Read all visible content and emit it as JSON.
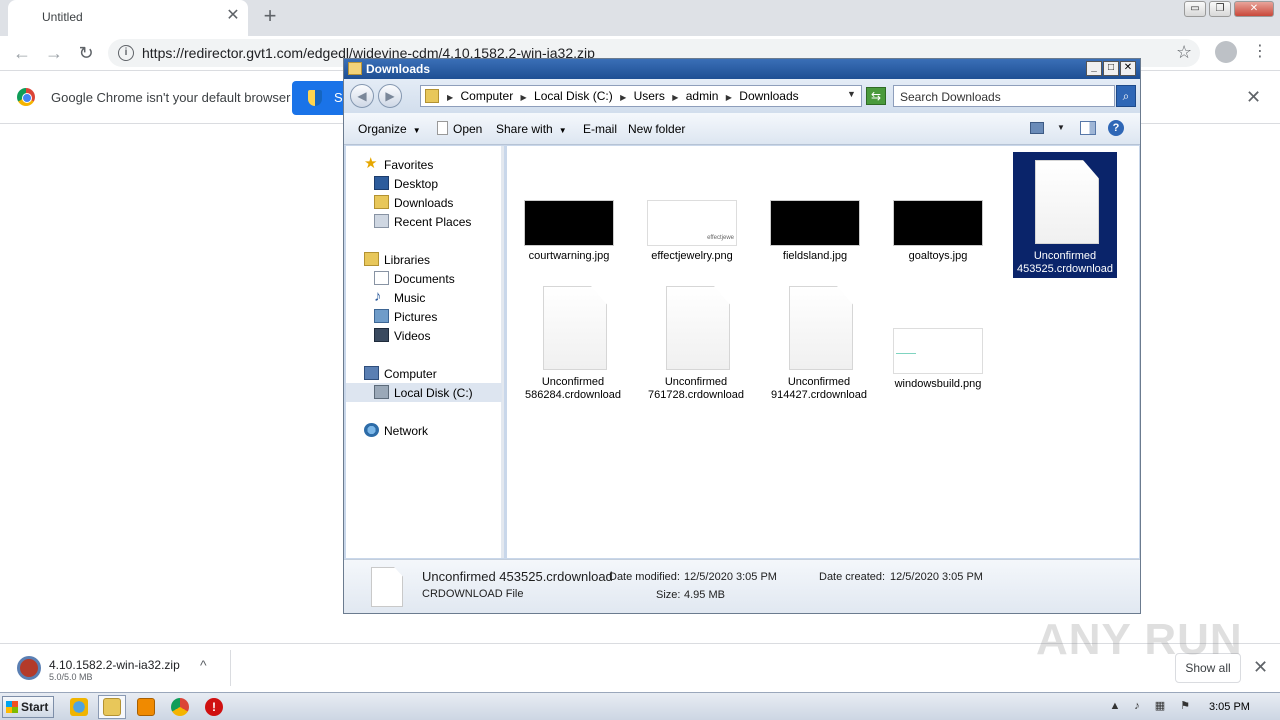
{
  "browser": {
    "tab_title": "Untitled",
    "tab_close": "✕",
    "new_tab": "+",
    "url": "https://redirector.gvt1.com/edgedl/widevine-cdm/4.10.1582.2-win-ia32.zip",
    "info_icon": "i",
    "star_icon": "☆",
    "menu_icon": "⋮",
    "back_icon": "←",
    "forward_icon": "→",
    "reload_icon": "↻",
    "win_controls": [
      "▭",
      "❐",
      "✕"
    ]
  },
  "infobar": {
    "text": "Google Chrome isn't your default browser",
    "button_label": "S",
    "close": "✕"
  },
  "explorer": {
    "title": "Downloads",
    "caption_buttons": [
      "_",
      "□",
      "✕"
    ],
    "breadcrumbs": [
      "Computer",
      "Local Disk (C:)",
      "Users",
      "admin",
      "Downloads"
    ],
    "search_placeholder": "Search Downloads",
    "commands": {
      "organize": "Organize",
      "open": "Open",
      "share_with": "Share with",
      "email": "E-mail",
      "new_folder": "New folder",
      "help": "?"
    },
    "nav": {
      "favorites": "Favorites",
      "desktop": "Desktop",
      "downloads": "Downloads",
      "recent_places": "Recent Places",
      "libraries": "Libraries",
      "documents": "Documents",
      "music": "Music",
      "pictures": "Pictures",
      "videos": "Videos",
      "computer": "Computer",
      "local_disk": "Local Disk (C:)",
      "network": "Network"
    },
    "files": [
      {
        "name": "courtwarning.jpg",
        "kind": "dark-thumb"
      },
      {
        "name": "effectjewelry.png",
        "kind": "light-thumb",
        "thumb_text": "effectjewe"
      },
      {
        "name": "fieldsland.jpg",
        "kind": "dark-thumb"
      },
      {
        "name": "goaltoys.jpg",
        "kind": "dark-thumb"
      },
      {
        "name_line1": "Unconfirmed",
        "name_line2": "453525.crdownload",
        "kind": "doc",
        "selected": true
      },
      {
        "name_line1": "Unconfirmed",
        "name_line2": "586284.crdownload",
        "kind": "doc"
      },
      {
        "name_line1": "Unconfirmed",
        "name_line2": "761728.crdownload",
        "kind": "doc"
      },
      {
        "name_line1": "Unconfirmed",
        "name_line2": "914427.crdownload",
        "kind": "doc"
      },
      {
        "name": "windowsbuild.png",
        "kind": "light-thumb"
      }
    ],
    "details": {
      "filename": "Unconfirmed 453525.crdownload",
      "filetype": "CRDOWNLOAD File",
      "modified_label": "Date modified:",
      "modified_value": "12/5/2020 3:05 PM",
      "created_label": "Date created:",
      "created_value": "12/5/2020 3:05 PM",
      "size_label": "Size:",
      "size_value": "4.95 MB"
    }
  },
  "download_shelf": {
    "filename": "4.10.1582.2-win-ia32.zip",
    "progress": "5.0/5.0 MB",
    "caret": "^",
    "show_all": "Show all",
    "close": "✕"
  },
  "watermark": "ANY RUN",
  "taskbar": {
    "start_label": "Start",
    "clock": "3:05 PM",
    "icons": [
      "ie-icon",
      "explorer-icon",
      "media-player-icon",
      "chrome-icon",
      "stop-icon"
    ]
  }
}
